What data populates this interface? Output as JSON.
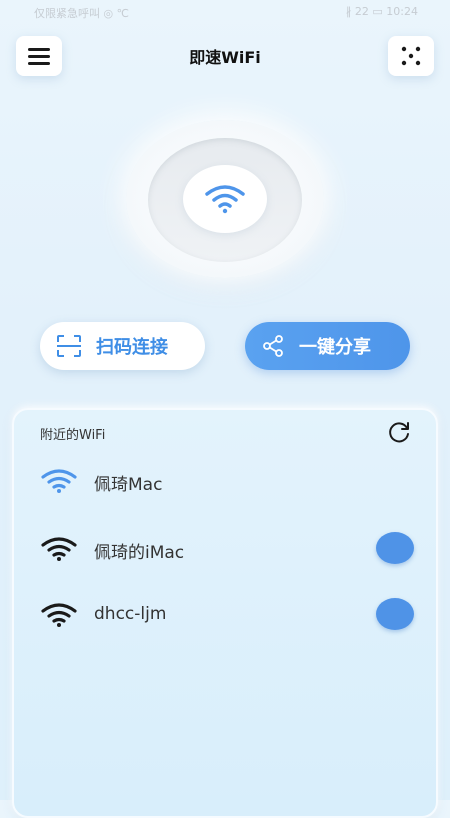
{
  "status_bar": {
    "left": "仅限紧急呼叫 ◎ ℃",
    "right": "∦ 22 ▭ 10:24"
  },
  "header": {
    "title": "即速WiFi",
    "menu_icon": "hamburger-menu-icon",
    "scan_icon": "dice-scan-icon"
  },
  "center": {
    "icon": "wifi-icon",
    "accent_color": "#4e95ea"
  },
  "actions": {
    "scan_connect_label": "扫码连接",
    "share_label": "一键分享"
  },
  "nearby": {
    "title": "附近的WiFi",
    "refresh_icon": "refresh-icon",
    "networks": [
      {
        "name": "佩琦Mac",
        "connected": true
      },
      {
        "name": "佩琦的iMac",
        "connected": false
      },
      {
        "name": "dhcc-ljm",
        "connected": false
      }
    ]
  }
}
